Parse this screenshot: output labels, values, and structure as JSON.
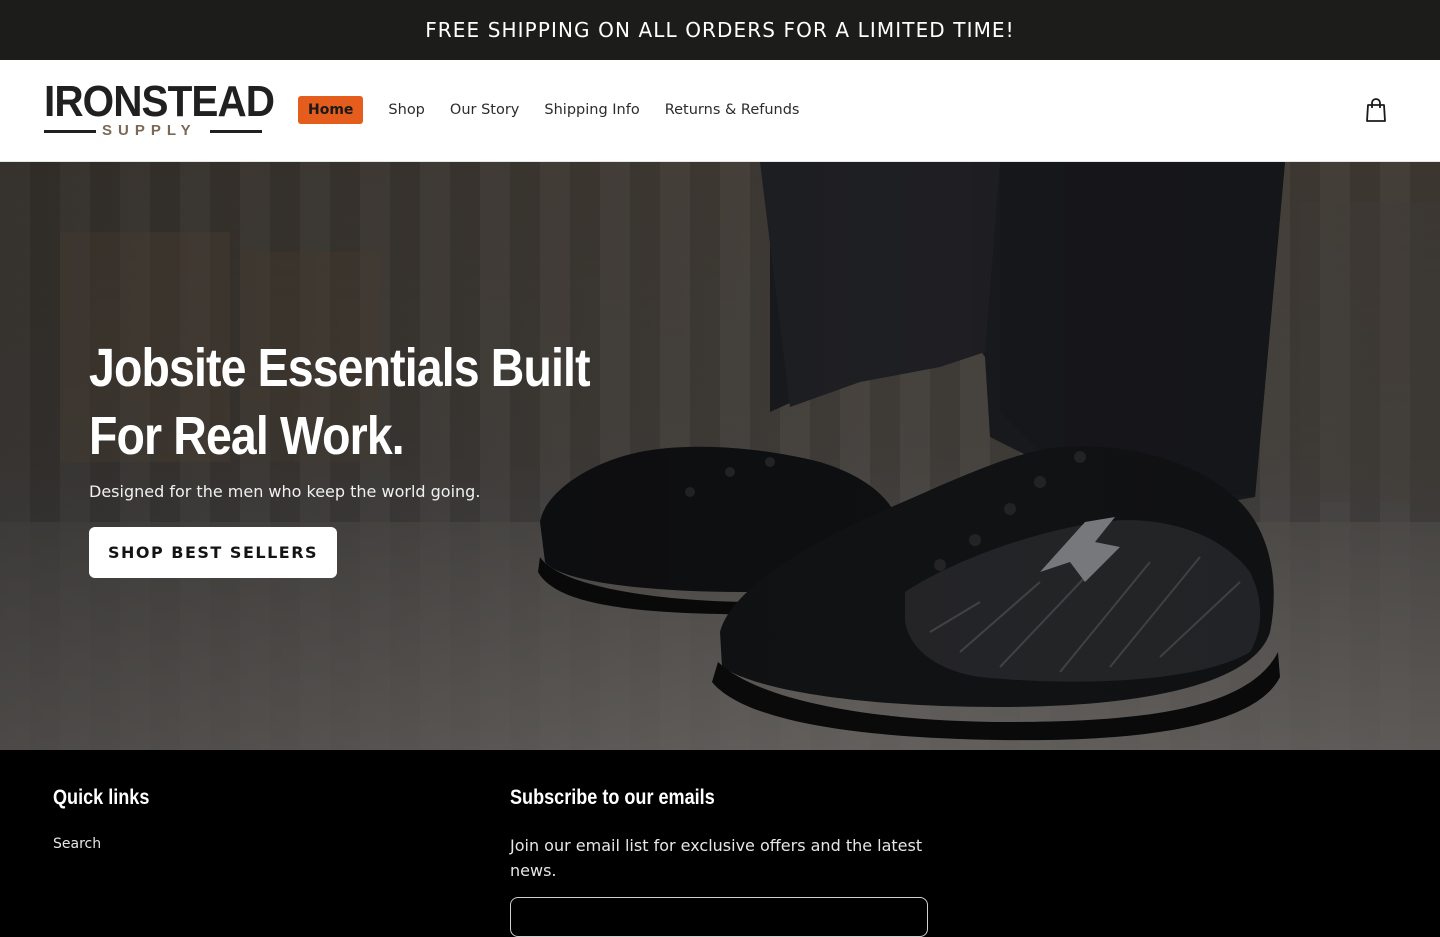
{
  "announcement": {
    "text": "FREE SHIPPING ON ALL ORDERS FOR A LIMITED TIME!"
  },
  "header": {
    "logo": {
      "top": "IRONSTEAD",
      "bottom": "SUPPLY"
    },
    "nav": [
      {
        "label": "Home",
        "active": true
      },
      {
        "label": "Shop",
        "active": false
      },
      {
        "label": "Our Story",
        "active": false
      },
      {
        "label": "Shipping Info",
        "active": false
      },
      {
        "label": "Returns & Refunds",
        "active": false
      }
    ],
    "cart_icon": "shopping-bag-icon",
    "accent_color": "#e45d1c"
  },
  "hero": {
    "title": "Jobsite Essentials Built For Real Work.",
    "subtitle": "Designed for the men who keep the world going.",
    "button_label": "SHOP BEST SELLERS"
  },
  "footer": {
    "quick_links": {
      "heading": "Quick links",
      "links": [
        "Search"
      ]
    },
    "subscribe": {
      "heading": "Subscribe to our emails",
      "text": "Join our email list for exclusive offers and the latest news."
    }
  }
}
